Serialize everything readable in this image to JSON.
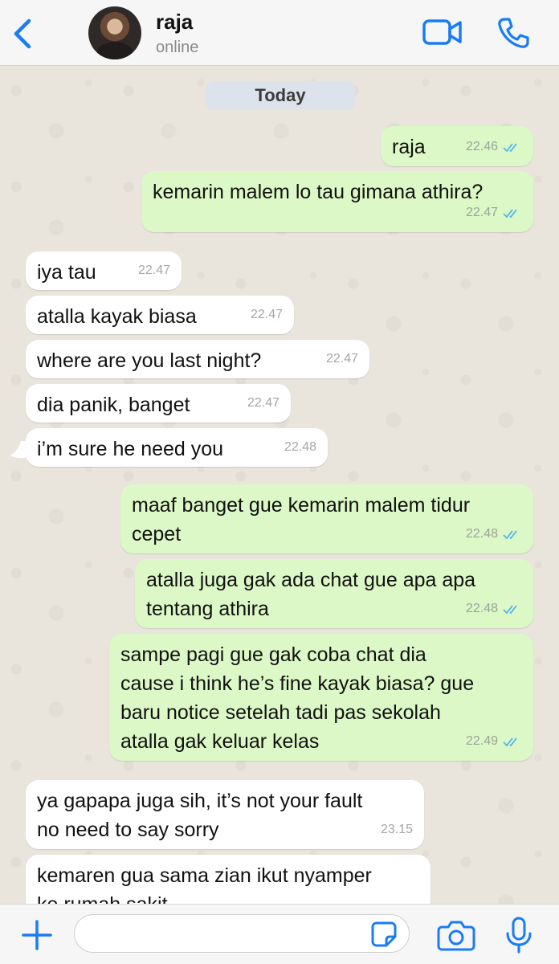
{
  "header": {
    "contact_name": "raja",
    "status": "online"
  },
  "chat": {
    "date_label": "Today",
    "messages": [
      {
        "dir": "out",
        "text": "raja",
        "time": "22.46",
        "read": true
      },
      {
        "dir": "out",
        "text": "kemarin malem lo tau gimana athira?",
        "time": "22.47",
        "read": true
      },
      {
        "dir": "in",
        "text": "iya tau",
        "time": "22.47"
      },
      {
        "dir": "in",
        "text": "atalla kayak biasa",
        "time": "22.47"
      },
      {
        "dir": "in",
        "text": "where are you last night?",
        "time": "22.47"
      },
      {
        "dir": "in",
        "text": "dia panik, banget",
        "time": "22.47"
      },
      {
        "dir": "in",
        "text": "i’m sure he need you",
        "time": "22.48"
      },
      {
        "dir": "out",
        "text": "maaf banget gue kemarin malem tidur\ncepet",
        "time": "22.48",
        "read": true
      },
      {
        "dir": "out",
        "text": "atalla juga gak ada chat gue apa apa\ntentang athira",
        "time": "22.48",
        "read": true
      },
      {
        "dir": "out",
        "text": "sampe pagi gue gak coba chat dia\ncause i think he’s fine kayak biasa? gue\nbaru notice setelah tadi pas sekolah\natalla gak keluar kelas",
        "time": "22.49",
        "read": true
      },
      {
        "dir": "in",
        "text": "ya gapapa juga sih, it’s not your fault\nno need to say sorry",
        "time": "23.15"
      },
      {
        "dir": "in",
        "text": "kemaren gua sama zian ikut nyamper\nke rumah sakit",
        "time": ""
      }
    ]
  },
  "footer": {
    "input_value": "",
    "input_placeholder": ""
  },
  "colors": {
    "accent": "#1a7cf5",
    "outgoing_bubble": "#dcf8c6",
    "incoming_bubble": "#ffffff",
    "read_ticks": "#4fb6ec",
    "wallpaper": "#e9e4dc"
  },
  "icons": {
    "back": "chevron-left-icon",
    "video": "video-camera-icon",
    "call": "phone-icon",
    "plus": "plus-icon",
    "sticker": "sticker-icon",
    "camera": "camera-icon",
    "mic": "microphone-icon",
    "read_receipt": "double-check-icon"
  }
}
